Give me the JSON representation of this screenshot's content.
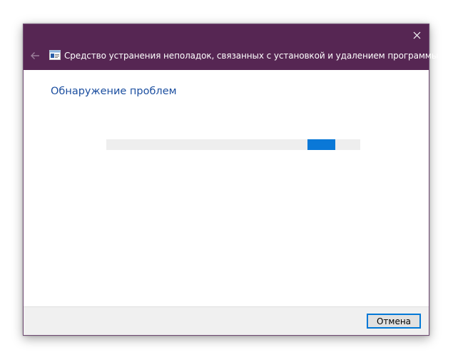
{
  "window": {
    "title": "Средство устранения неполадок, связанных с установкой и удалением программы",
    "titlebar_color": "#562653",
    "back_icon": "back-arrow-icon",
    "close_icon": "close-icon",
    "app_icon": "troubleshooter-icon"
  },
  "main": {
    "heading": "Обнаружение проблем",
    "heading_color": "#1c4fa0",
    "progress": {
      "indeterminate": true,
      "accent_color": "#0a78d7"
    }
  },
  "footer": {
    "cancel_label": "Отмена"
  }
}
